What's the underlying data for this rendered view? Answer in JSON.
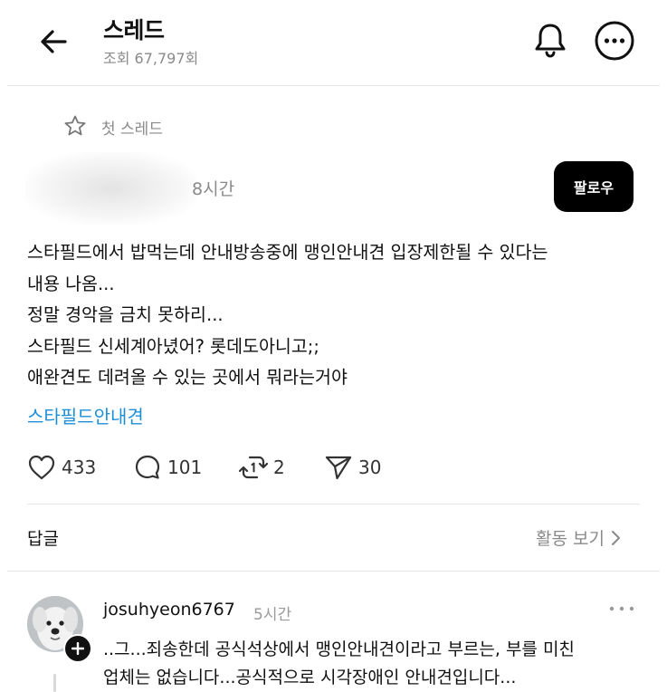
{
  "header": {
    "title": "스레드",
    "views": "조회 67,797회"
  },
  "post": {
    "first_thread_label": "첫 스레드",
    "time": "8시간",
    "follow_label": "팔로우",
    "lines": [
      "스타필드에서 밥먹는데 안내방송중에 맹인안내견 입장제한될 수 있다는",
      "내용 나옴...",
      "정말 경악을 금치 못하리...",
      "스타필드 신세계아녔어? 롯데도아니고;;",
      "애완견도 데려올 수 있는 곳에서 뭐라는거야"
    ],
    "tag": "스타필드안내견",
    "actions": {
      "likes": "433",
      "comments": "101",
      "reposts": "2",
      "shares": "30"
    }
  },
  "replies_section": {
    "label": "답글",
    "activity_label": "활동 보기"
  },
  "reply": {
    "username": "josuhyeon6767",
    "time": "5시간",
    "lines": [
      "..그...죄송한데 공식석상에서 맹인안내견이라고 부르는, 부를 미친",
      "업체는 없습니다...공식적으로 시각장애인 안내견입니다..."
    ]
  },
  "icons": {
    "back": "arrow-left-icon",
    "bell": "bell-icon",
    "more": "more-horizontal-icon",
    "star": "star-icon",
    "like": "heart-icon",
    "comment": "comment-icon",
    "repost": "repost-icon",
    "share": "send-icon"
  }
}
